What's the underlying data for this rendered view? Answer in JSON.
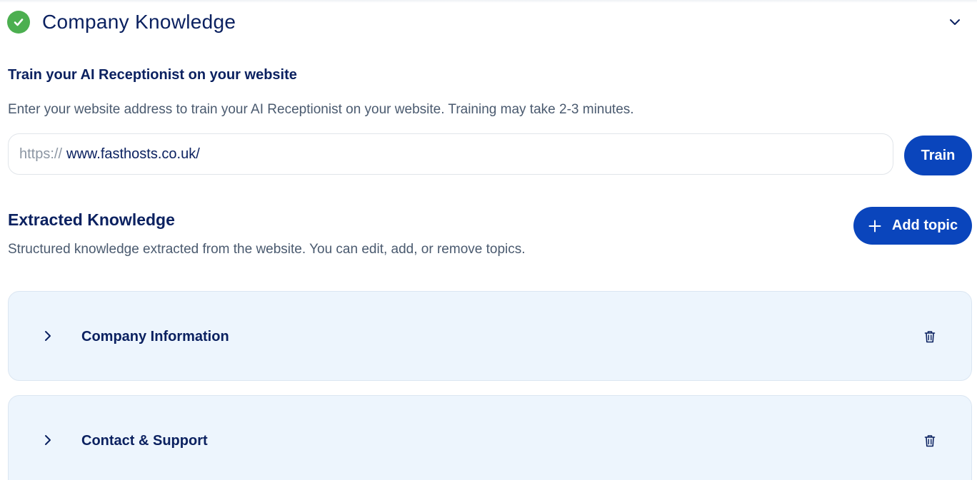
{
  "section": {
    "title": "Company Knowledge",
    "status_icon": "check-circle-icon",
    "collapse_icon": "chevron-down-icon"
  },
  "train": {
    "heading": "Train your AI Receptionist on your website",
    "description": "Enter your website address to train your AI Receptionist on your website. Training may take 2-3 minutes.",
    "url_prefix": "https://",
    "url_value": "www.fasthosts.co.uk/",
    "button_label": "Train"
  },
  "extracted": {
    "heading": "Extracted Knowledge",
    "description": "Structured knowledge extracted from the website. You can edit, add, or remove topics.",
    "add_button_label": "Add topic",
    "add_button_icon": "plus-icon"
  },
  "topics": [
    {
      "label": "Company Information",
      "expand_icon": "chevron-right-icon",
      "delete_icon": "trash-icon"
    },
    {
      "label": "Contact & Support",
      "expand_icon": "chevron-right-icon",
      "delete_icon": "trash-icon"
    }
  ],
  "colors": {
    "primary": "#0a45bc",
    "heading_text": "#0b2160",
    "body_text": "#4a5a6f",
    "success": "#4caf50",
    "card_background": "#edf5fd"
  }
}
